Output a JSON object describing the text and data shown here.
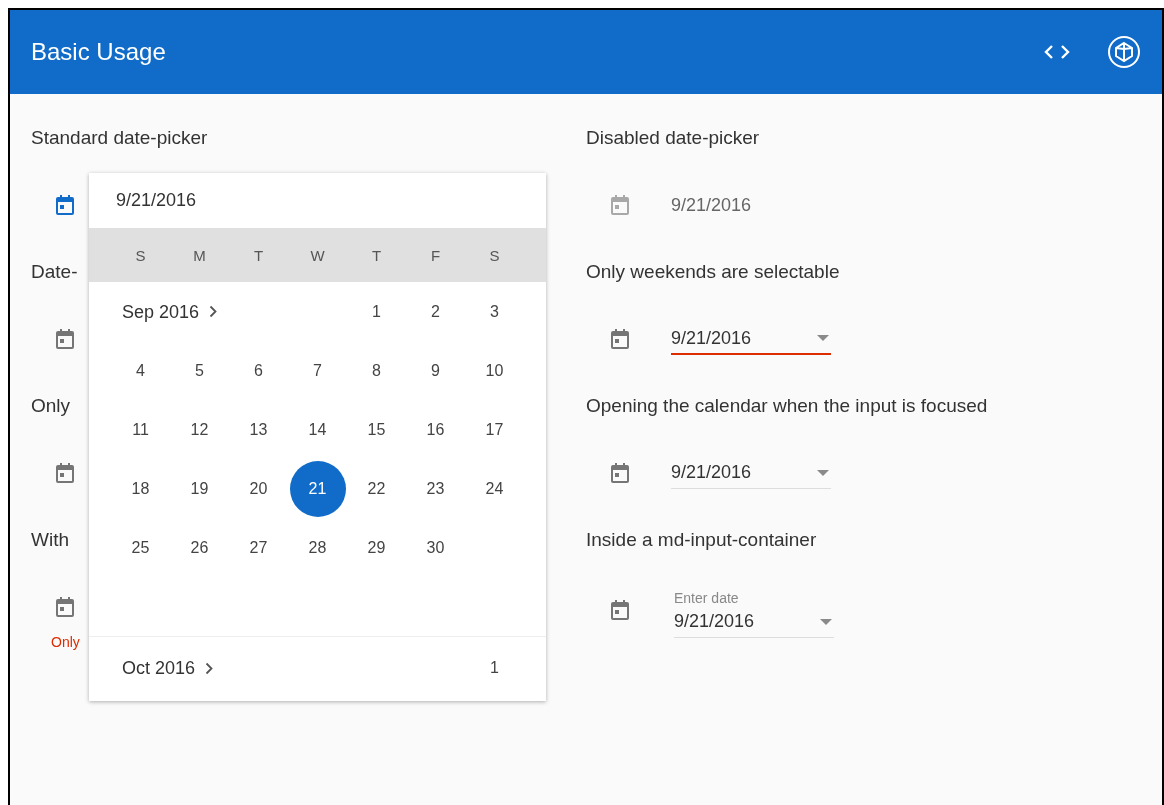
{
  "toolbar": {
    "title": "Basic Usage"
  },
  "left_sections": [
    {
      "label": "Standard date-picker",
      "focused": true
    },
    {
      "label": "Date-",
      "focused": false
    },
    {
      "label": "Only",
      "focused": false
    },
    {
      "label": "With",
      "focused": false,
      "error": "Only"
    }
  ],
  "right_sections": [
    {
      "label": "Disabled date-picker",
      "kind": "plain",
      "value": "9/21/2016",
      "disabled": true,
      "invalid": false
    },
    {
      "label": "Only weekends are selectable",
      "kind": "dropdown",
      "value": "9/21/2016",
      "disabled": false,
      "invalid": true
    },
    {
      "label": "Opening the calendar when the input is focused",
      "kind": "dropdown",
      "value": "9/21/2016",
      "disabled": false,
      "invalid": false
    },
    {
      "label": "Inside a md-input-container",
      "kind": "floating",
      "placeholder": "Enter date",
      "value": "9/21/2016",
      "disabled": false,
      "invalid": false
    }
  ],
  "calendar": {
    "value": "9/21/2016",
    "weekdays": [
      "S",
      "M",
      "T",
      "W",
      "T",
      "F",
      "S"
    ],
    "months": [
      {
        "label": "Sep 2016",
        "weeks": [
          [
            {
              "day": "1",
              "selected": false
            },
            {
              "day": "2",
              "selected": false
            },
            {
              "day": "3",
              "selected": false
            }
          ],
          [
            {
              "day": "4",
              "selected": false
            },
            {
              "day": "5",
              "selected": false
            },
            {
              "day": "6",
              "selected": false
            },
            {
              "day": "7",
              "selected": false
            },
            {
              "day": "8",
              "selected": false
            },
            {
              "day": "9",
              "selected": false
            },
            {
              "day": "10",
              "selected": false
            }
          ],
          [
            {
              "day": "11",
              "selected": false
            },
            {
              "day": "12",
              "selected": false
            },
            {
              "day": "13",
              "selected": false
            },
            {
              "day": "14",
              "selected": false
            },
            {
              "day": "15",
              "selected": false
            },
            {
              "day": "16",
              "selected": false
            },
            {
              "day": "17",
              "selected": false
            }
          ],
          [
            {
              "day": "18",
              "selected": false
            },
            {
              "day": "19",
              "selected": false
            },
            {
              "day": "20",
              "selected": false
            },
            {
              "day": "21",
              "selected": true
            },
            {
              "day": "22",
              "selected": false
            },
            {
              "day": "23",
              "selected": false
            },
            {
              "day": "24",
              "selected": false
            }
          ],
          [
            {
              "day": "25",
              "selected": false
            },
            {
              "day": "26",
              "selected": false
            },
            {
              "day": "27",
              "selected": false
            },
            {
              "day": "28",
              "selected": false
            },
            {
              "day": "29",
              "selected": false
            },
            {
              "day": "30",
              "selected": false
            }
          ]
        ]
      },
      {
        "label": "Oct 2016",
        "weeks": [
          [
            {
              "day": "1",
              "selected": false
            }
          ]
        ]
      }
    ]
  }
}
